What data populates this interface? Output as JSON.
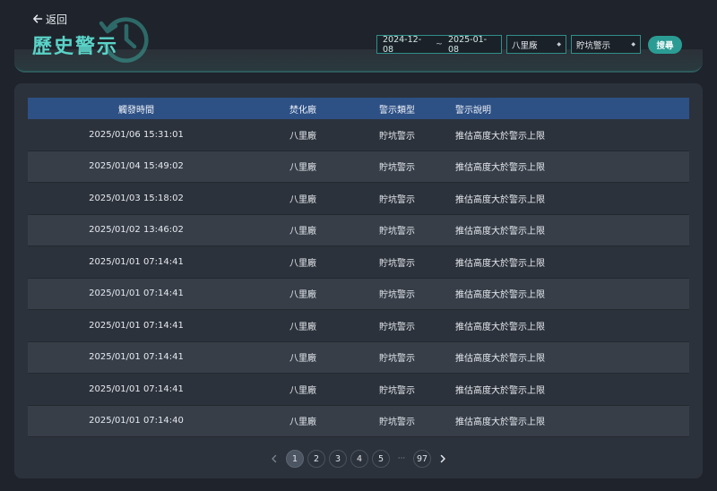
{
  "header": {
    "back_label": "返回",
    "title": "歷史警示",
    "icons": {
      "back": "arrow-left-icon",
      "history": "clock-history-icon"
    }
  },
  "filters": {
    "date_start": "2024-12-08",
    "date_separator": "~",
    "date_end": "2025-01-08",
    "plant_selected": "八里廠",
    "type_selected": "貯坑警示",
    "search_label": "搜尋"
  },
  "table": {
    "columns": [
      "觸發時間",
      "焚化廠",
      "警示類型",
      "警示說明"
    ],
    "rows": [
      {
        "time": "2025/01/06 15:31:01",
        "plant": "八里廠",
        "type": "貯坑警示",
        "desc": "推估高度大於警示上限"
      },
      {
        "time": "2025/01/04 15:49:02",
        "plant": "八里廠",
        "type": "貯坑警示",
        "desc": "推估高度大於警示上限"
      },
      {
        "time": "2025/01/03 15:18:02",
        "plant": "八里廠",
        "type": "貯坑警示",
        "desc": "推估高度大於警示上限"
      },
      {
        "time": "2025/01/02 13:46:02",
        "plant": "八里廠",
        "type": "貯坑警示",
        "desc": "推估高度大於警示上限"
      },
      {
        "time": "2025/01/01 07:14:41",
        "plant": "八里廠",
        "type": "貯坑警示",
        "desc": "推估高度大於警示上限"
      },
      {
        "time": "2025/01/01 07:14:41",
        "plant": "八里廠",
        "type": "貯坑警示",
        "desc": "推估高度大於警示上限"
      },
      {
        "time": "2025/01/01 07:14:41",
        "plant": "八里廠",
        "type": "貯坑警示",
        "desc": "推估高度大於警示上限"
      },
      {
        "time": "2025/01/01 07:14:41",
        "plant": "八里廠",
        "type": "貯坑警示",
        "desc": "推估高度大於警示上限"
      },
      {
        "time": "2025/01/01 07:14:41",
        "plant": "八里廠",
        "type": "貯坑警示",
        "desc": "推估高度大於警示上限"
      },
      {
        "time": "2025/01/01 07:14:40",
        "plant": "八里廠",
        "type": "貯坑警示",
        "desc": "推估高度大於警示上限"
      }
    ]
  },
  "pagination": {
    "pages": [
      "1",
      "2",
      "3",
      "4",
      "5"
    ],
    "ellipsis": "···",
    "last_page": "97",
    "current": "1"
  },
  "colors": {
    "accent": "#5ad3c8",
    "button": "#2b9c94",
    "table_header": "#2d5085",
    "background": "#1f232b",
    "panel": "#2c323b"
  }
}
